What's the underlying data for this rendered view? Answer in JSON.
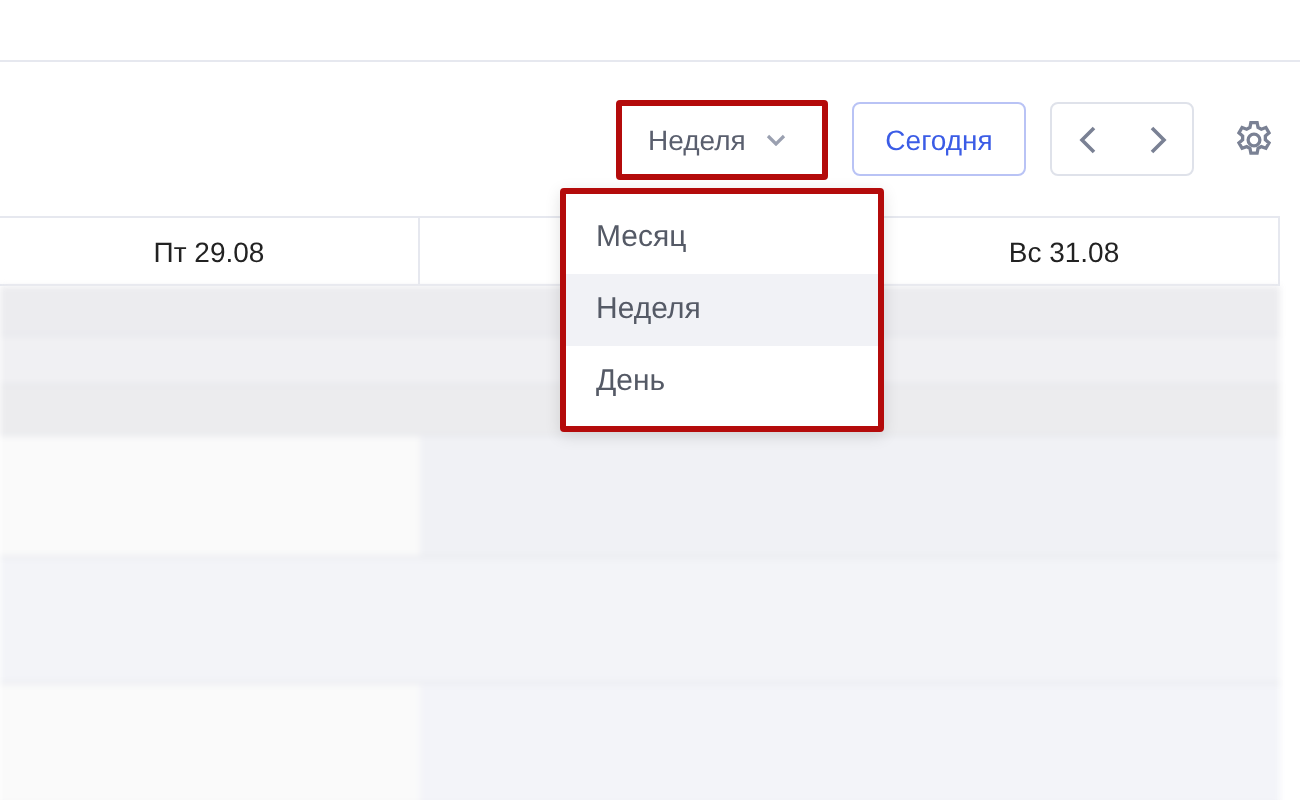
{
  "toolbar": {
    "view_select": {
      "value": "Неделя",
      "highlighted": true
    },
    "today_button": "Сегодня"
  },
  "calendar": {
    "columns": [
      {
        "label": "Пт 29.08"
      },
      {},
      {
        "label": "Вс 31.08"
      }
    ]
  },
  "view_menu": {
    "highlighted": true,
    "items": [
      {
        "label": "Месяц",
        "selected": false
      },
      {
        "label": "Неделя",
        "selected": true
      },
      {
        "label": "День",
        "selected": false
      }
    ]
  }
}
